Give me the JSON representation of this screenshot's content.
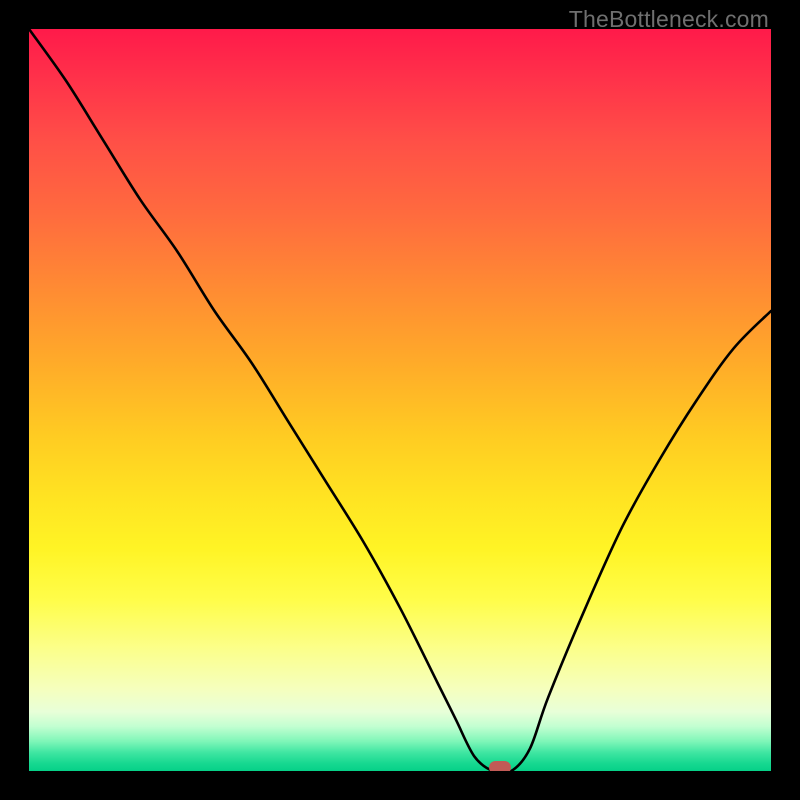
{
  "watermark": "TheBottleneck.com",
  "accent_colors": {
    "curve": "#000000",
    "marker": "#c15a56",
    "background_frame": "#000000"
  },
  "chart_data": {
    "type": "line",
    "title": "",
    "xlabel": "",
    "ylabel": "",
    "xlim": [
      0,
      1
    ],
    "ylim": [
      0,
      1
    ],
    "grid": false,
    "legend": false,
    "x": [
      0.0,
      0.05,
      0.1,
      0.15,
      0.2,
      0.25,
      0.3,
      0.35,
      0.4,
      0.45,
      0.5,
      0.55,
      0.575,
      0.6,
      0.625,
      0.65,
      0.675,
      0.7,
      0.75,
      0.8,
      0.85,
      0.9,
      0.95,
      1.0
    ],
    "y": [
      1.0,
      0.93,
      0.85,
      0.77,
      0.7,
      0.62,
      0.55,
      0.47,
      0.39,
      0.31,
      0.22,
      0.12,
      0.07,
      0.02,
      0.0,
      0.0,
      0.03,
      0.1,
      0.22,
      0.33,
      0.42,
      0.5,
      0.57,
      0.62
    ],
    "marker": {
      "x": 0.635,
      "y": 0.0
    },
    "notes": "Axes are unlabeled in the source image. Values are normalized 0–1; y is fraction of plot height from bottom, x is fraction of plot width from left. Curve descends steeply from top-left, flattens near x≈0.63 at y≈0, then rises again toward the right edge reaching ≈0.62."
  }
}
